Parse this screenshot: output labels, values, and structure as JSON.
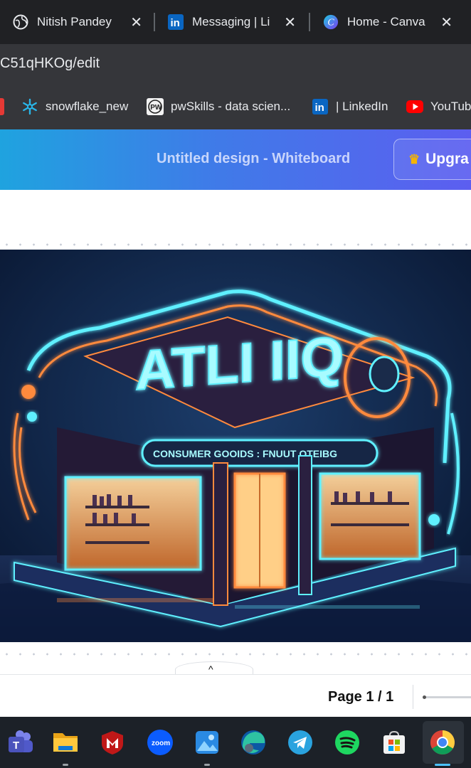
{
  "browser": {
    "tabs": [
      {
        "title": "Nitish Pandey",
        "icon": "globe-icon"
      },
      {
        "title": "Messaging | Li",
        "icon": "linkedin-icon"
      },
      {
        "title": "Home - Canva",
        "icon": "canva-icon"
      }
    ],
    "close_glyph": "✕",
    "address": "C51qHKOg/edit",
    "bookmarks": [
      {
        "label": "snowflake_new",
        "icon": "snowflake-icon"
      },
      {
        "label": "pwSkills - data scien...",
        "icon": "pwskills-icon"
      },
      {
        "label": "| LinkedIn",
        "icon": "linkedin-icon"
      },
      {
        "label": "YouTub",
        "icon": "youtube-icon"
      }
    ]
  },
  "canva": {
    "design_title": "Untitled design - Whiteboard",
    "upgrade_label": "Upgra",
    "artwork": {
      "sign_text": "ATLI IIQ",
      "banner_text": "CONSUMER GOOIDS : FNUUT OTEIBG"
    },
    "page_indicator": "Page 1 / 1",
    "collapse_glyph": "^"
  },
  "taskbar": {
    "apps": [
      "teams-icon",
      "file-explorer-icon",
      "mcafee-icon",
      "zoom-icon",
      "photos-icon",
      "edge-icon",
      "telegram-icon",
      "spotify-icon",
      "store-icon",
      "chrome-icon"
    ],
    "zoom_label": "zoom"
  },
  "colors": {
    "header_gradient_start": "#1fa3df",
    "header_gradient_end": "#5c5ef0",
    "neon_cyan": "#5ff0ff",
    "neon_orange": "#ff8a3d"
  }
}
